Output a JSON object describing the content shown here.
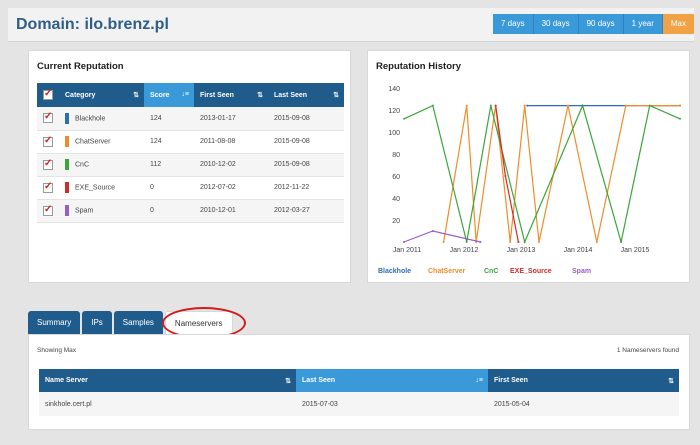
{
  "header": {
    "title": "Domain: ilo.brenz.pl",
    "ranges": [
      "7 days",
      "30 days",
      "90 days",
      "1 year",
      "Max"
    ]
  },
  "reputation": {
    "title": "Current Reputation",
    "columns": [
      "Category",
      "Score",
      "First Seen",
      "Last Seen"
    ],
    "rows": [
      {
        "category": "Blackhole",
        "score": "124",
        "first_seen": "2013-01-17",
        "last_seen": "2015-09-08",
        "color": "#2f6db3"
      },
      {
        "category": "ChatServer",
        "score": "124",
        "first_seen": "2011-08-08",
        "last_seen": "2015-09-08",
        "color": "#f08c2a"
      },
      {
        "category": "CnC",
        "score": "112",
        "first_seen": "2010-12-02",
        "last_seen": "2015-09-08",
        "color": "#3aa53a"
      },
      {
        "category": "EXE_Source",
        "score": "0",
        "first_seen": "2012-07-02",
        "last_seen": "2012-11-22",
        "color": "#d12a2a"
      },
      {
        "category": "Spam",
        "score": "0",
        "first_seen": "2010-12-01",
        "last_seen": "2012-03-27",
        "color": "#9a5fc4"
      }
    ]
  },
  "history": {
    "title": "Reputation History",
    "y_ticks": [
      "140",
      "120",
      "100",
      "80",
      "60",
      "40",
      "20"
    ],
    "x_ticks": [
      "Jan 2011",
      "Jan 2012",
      "Jan 2013",
      "Jan 2014",
      "Jan 2015"
    ],
    "legend": [
      "Blackhole",
      "ChatServer",
      "CnC",
      "EXE_Source",
      "Spam"
    ]
  },
  "chart_data": {
    "type": "line",
    "title": "Reputation History",
    "ylim": [
      0,
      140
    ],
    "x_range": [
      "2010-12-01",
      "2015-09-08"
    ],
    "series": [
      {
        "name": "Blackhole",
        "color": "#2f6db3",
        "x": [
          "2013-01-17",
          "2015-09-08"
        ],
        "values": [
          124,
          124
        ]
      },
      {
        "name": "ChatServer",
        "color": "#f08c2a",
        "x": [
          "2011-08-08",
          "2012-01-01",
          "2012-03-01",
          "2012-07-01",
          "2012-10-01",
          "2013-01-01",
          "2013-04-01",
          "2013-10-01",
          "2014-04-01",
          "2014-10-01",
          "2015-09-08"
        ],
        "values": [
          0,
          124,
          0,
          124,
          0,
          124,
          0,
          124,
          0,
          124,
          124
        ]
      },
      {
        "name": "CnC",
        "color": "#3aa53a",
        "x": [
          "2010-12-02",
          "2011-06-01",
          "2012-01-01",
          "2012-06-01",
          "2013-01-01",
          "2014-01-01",
          "2014-09-01",
          "2015-03-01",
          "2015-09-08"
        ],
        "values": [
          112,
          124,
          0,
          124,
          0,
          124,
          0,
          124,
          112
        ]
      },
      {
        "name": "EXE_Source",
        "color": "#d12a2a",
        "x": [
          "2012-07-02",
          "2012-09-01",
          "2012-11-22"
        ],
        "values": [
          124,
          60,
          0
        ]
      },
      {
        "name": "Spam",
        "color": "#9a5fc4",
        "x": [
          "2010-12-01",
          "2011-06-01",
          "2012-03-27"
        ],
        "values": [
          0,
          10,
          0
        ]
      }
    ]
  },
  "tabs": {
    "items": [
      "Summary",
      "IPs",
      "Samples",
      "Nameservers"
    ],
    "active": "Nameservers"
  },
  "nameservers": {
    "showing": "Showing Max",
    "found": "1 Nameservers found",
    "columns": [
      "Name Server",
      "Last Seen",
      "First Seen"
    ],
    "rows": [
      {
        "name": "sinkhole.cert.pl",
        "last_seen": "2015-07-03",
        "first_seen": "2015-05-04"
      }
    ]
  }
}
